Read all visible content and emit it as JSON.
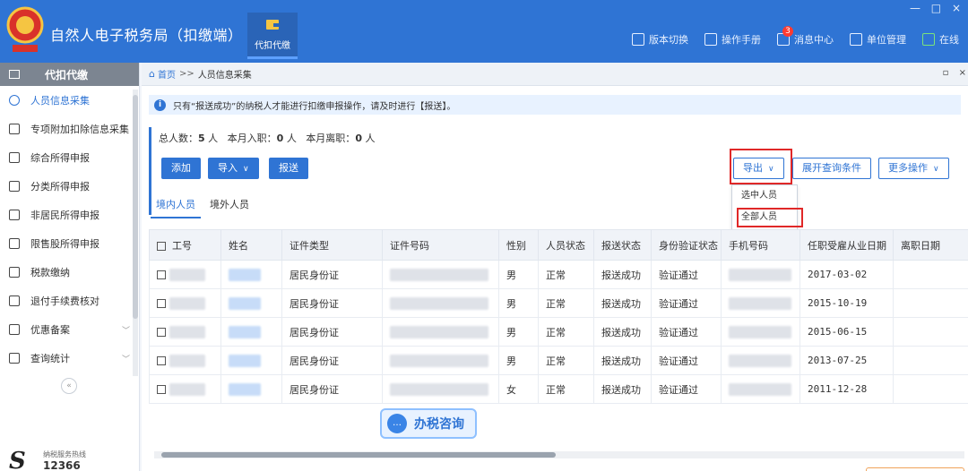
{
  "app": {
    "title": "自然人电子税务局（扣缴端）",
    "module_tab": "代扣代缴",
    "window_controls": [
      "—",
      "□",
      "×"
    ]
  },
  "toolbar": {
    "items": [
      {
        "label": "版本切换",
        "icon": "version-icon"
      },
      {
        "label": "操作手册",
        "icon": "manual-icon"
      },
      {
        "label": "消息中心",
        "icon": "message-icon",
        "badge": "3"
      },
      {
        "label": "单位管理",
        "icon": "company-icon"
      },
      {
        "label": "在线",
        "icon": "online-icon"
      }
    ]
  },
  "sidebar": {
    "header": "代扣代缴",
    "items": [
      {
        "label": "人员信息采集",
        "icon": "person-icon",
        "active": true
      },
      {
        "label": "专项附加扣除信息采集",
        "icon": "list-icon"
      },
      {
        "label": "综合所得申报",
        "icon": "layers-icon"
      },
      {
        "label": "分类所得申报",
        "icon": "pie-icon"
      },
      {
        "label": "非居民所得申报",
        "icon": "users-icon"
      },
      {
        "label": "限售股所得申报",
        "icon": "bar-icon"
      },
      {
        "label": "税款缴纳",
        "icon": "wallet-icon"
      },
      {
        "label": "退付手续费核对",
        "icon": "doc-icon"
      },
      {
        "label": "优惠备案",
        "icon": "file-icon",
        "chevron": "﹀"
      },
      {
        "label": "查询统计",
        "icon": "query-icon",
        "chevron": "﹀"
      }
    ],
    "collapse": "«",
    "hotline_label": "纳税服务热线",
    "hotline_number": "12366"
  },
  "breadcrumb": {
    "home": "首页",
    "separator": ">>",
    "current": "人员信息采集",
    "controls": [
      "▫",
      "×"
    ]
  },
  "notice": "只有“报送成功”的纳税人才能进行扣缴申报操作，请及时进行【报送】。",
  "stats": {
    "total_label": "总人数：",
    "total_value": "5",
    "total_unit": "人",
    "joined_label": "本月入职：",
    "joined_value": "0",
    "joined_unit": "人",
    "left_label": "本月离职：",
    "left_value": "0",
    "left_unit": "人"
  },
  "actions": {
    "add": "添加",
    "import": "导入",
    "submit": "报送",
    "export": "导出",
    "expand_query": "展开查询条件",
    "more": "更多操作"
  },
  "export_menu": [
    "选中人员",
    "全部人员"
  ],
  "tabs": [
    "境内人员",
    "境外人员"
  ],
  "table": {
    "headers": [
      "工号",
      "姓名",
      "证件类型",
      "证件号码",
      "性别",
      "人员状态",
      "报送状态",
      "身份验证状态",
      "手机号码",
      "任职受雇从业日期",
      "离职日期"
    ],
    "rows": [
      {
        "id_type": "居民身份证",
        "gender": "男",
        "status": "正常",
        "submit_status": "报送成功",
        "verify_status": "验证通过",
        "hire_date": "2017-03-02"
      },
      {
        "id_type": "居民身份证",
        "gender": "男",
        "status": "正常",
        "submit_status": "报送成功",
        "verify_status": "验证通过",
        "hire_date": "2015-10-19"
      },
      {
        "id_type": "居民身份证",
        "gender": "男",
        "status": "正常",
        "submit_status": "报送成功",
        "verify_status": "验证通过",
        "hire_date": "2015-06-15"
      },
      {
        "id_type": "居民身份证",
        "gender": "男",
        "status": "正常",
        "submit_status": "报送成功",
        "verify_status": "验证通过",
        "hire_date": "2013-07-25"
      },
      {
        "id_type": "居民身份证",
        "gender": "女",
        "status": "正常",
        "submit_status": "报送成功",
        "verify_status": "验证通过",
        "hire_date": "2011-12-28"
      }
    ]
  },
  "consult": "办税咨询",
  "colors": {
    "brand": "#2f74d4",
    "highlight": "#e02828",
    "online": "#7be37b"
  }
}
